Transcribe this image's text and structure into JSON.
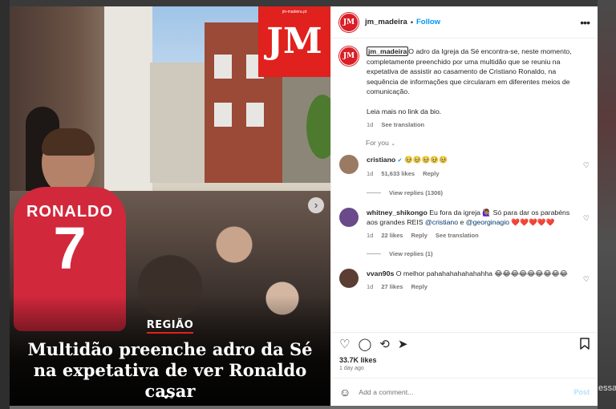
{
  "backdrop": {
    "right_text": "essag"
  },
  "media": {
    "logo_site": "jm-madeira.pt",
    "logo_letters": "JM",
    "shirt_name": "RONALDO",
    "shirt_number": "7",
    "region": "REGIÃO",
    "headline": "Multidão preenche adro da Sé na expetativa de ver Ronaldo casar",
    "carousel_dots": 2,
    "carousel_active": 1
  },
  "header": {
    "username": "jm_madeira",
    "separator": "•",
    "follow_label": "Follow",
    "more_icon": "more-horizontal-icon",
    "avatar_text": "JM"
  },
  "caption": {
    "username": "jm_madeira",
    "text": "O adro da Igreja da Sé encontra-se, neste momento, completamente preenchido por uma multidão que se reuniu na expetativa de assistir ao casamento de Cristiano Ronaldo, na sequência de informações que circularam em diferentes meios de comunicação.",
    "read_more": "Leia mais no link da bio.",
    "age": "1d",
    "translate": "See translation"
  },
  "for_you": {
    "label": "For you",
    "chevron": "⌄"
  },
  "comments": [
    {
      "username": "cristiano",
      "verified": "✔",
      "text": "🥹🥹🥹🥹🥹",
      "age": "1d",
      "likes": "51,633 likes",
      "reply": "Reply",
      "translate": "",
      "replies": "View replies (1306)",
      "avatar_color": "#9a7a63"
    },
    {
      "username": "whitney_shikongo",
      "text_before": "Eu fora da igreja 🙋🏽‍♀️ Só para dar os parabéns aos grandes REIS ",
      "mention1": "@cristiano",
      "text_mid": " e ",
      "mention2": "@georginagio",
      "text_after": " ❤️❤️❤️❤️❤️",
      "age": "1d",
      "likes": "22 likes",
      "reply": "Reply",
      "translate": "See translation",
      "replies": "View replies (1)",
      "avatar_color": "#6a4a8a"
    },
    {
      "username": "vvan90s",
      "text": "O melhor pahahahahahahahha 😂😂😂😂😂😂😂😂😂",
      "age": "1d",
      "likes": "27 likes",
      "reply": "Reply",
      "translate": "",
      "replies": "",
      "avatar_color": "#5a3e33"
    }
  ],
  "actions": {
    "like_icon": "heart-icon",
    "comment_icon": "comment-icon",
    "share_icon": "repost-icon",
    "send_icon": "send-icon",
    "save_icon": "bookmark-icon"
  },
  "stats": {
    "likes": "33.7K likes",
    "ago": "1 day ago"
  },
  "composer": {
    "placeholder": "Add a comment...",
    "post_label": "Post",
    "emoji_icon": "emoji-icon"
  }
}
